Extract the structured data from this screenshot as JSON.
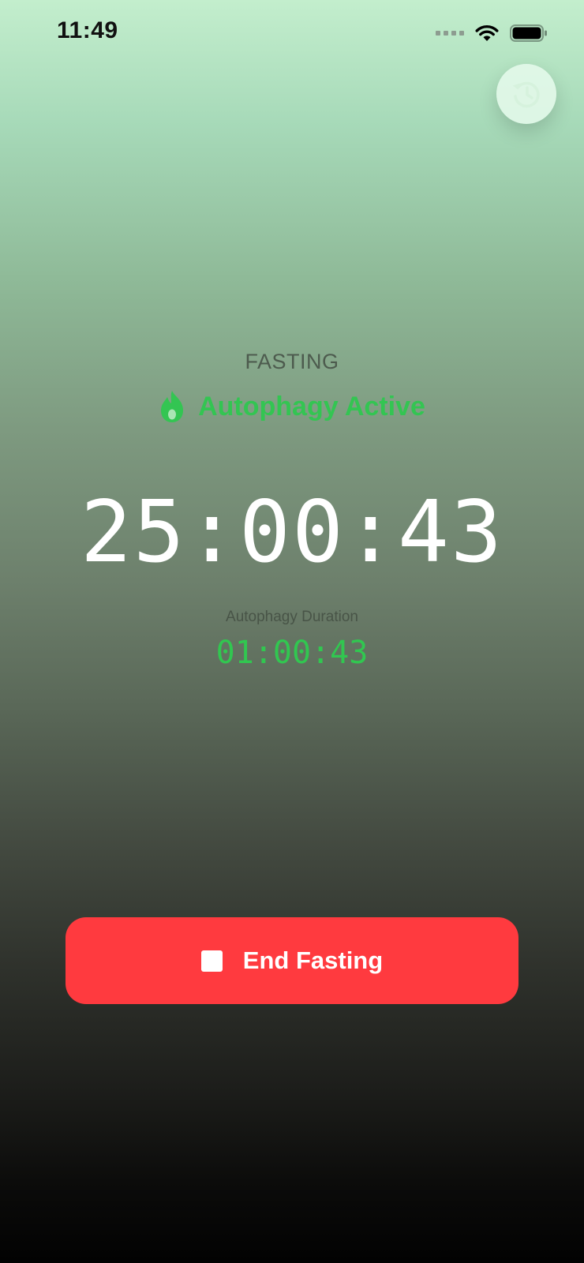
{
  "status_bar": {
    "time": "11:49",
    "icons": [
      "signal-dots-icon",
      "wifi-icon",
      "battery-icon"
    ]
  },
  "history_button": {
    "icon": "history-icon"
  },
  "fasting": {
    "state_label": "FASTING",
    "phase_icon": "flame-icon",
    "phase_label": "Autophagy Active",
    "elapsed": "25:00:43",
    "autophagy_label": "Autophagy Duration",
    "autophagy_elapsed": "01:00:43"
  },
  "end_button": {
    "icon": "stop-icon",
    "label": "End Fasting"
  },
  "colors": {
    "accent_green": "#33c552",
    "danger_red": "#ff3a3f",
    "timer_white": "#ffffff"
  }
}
